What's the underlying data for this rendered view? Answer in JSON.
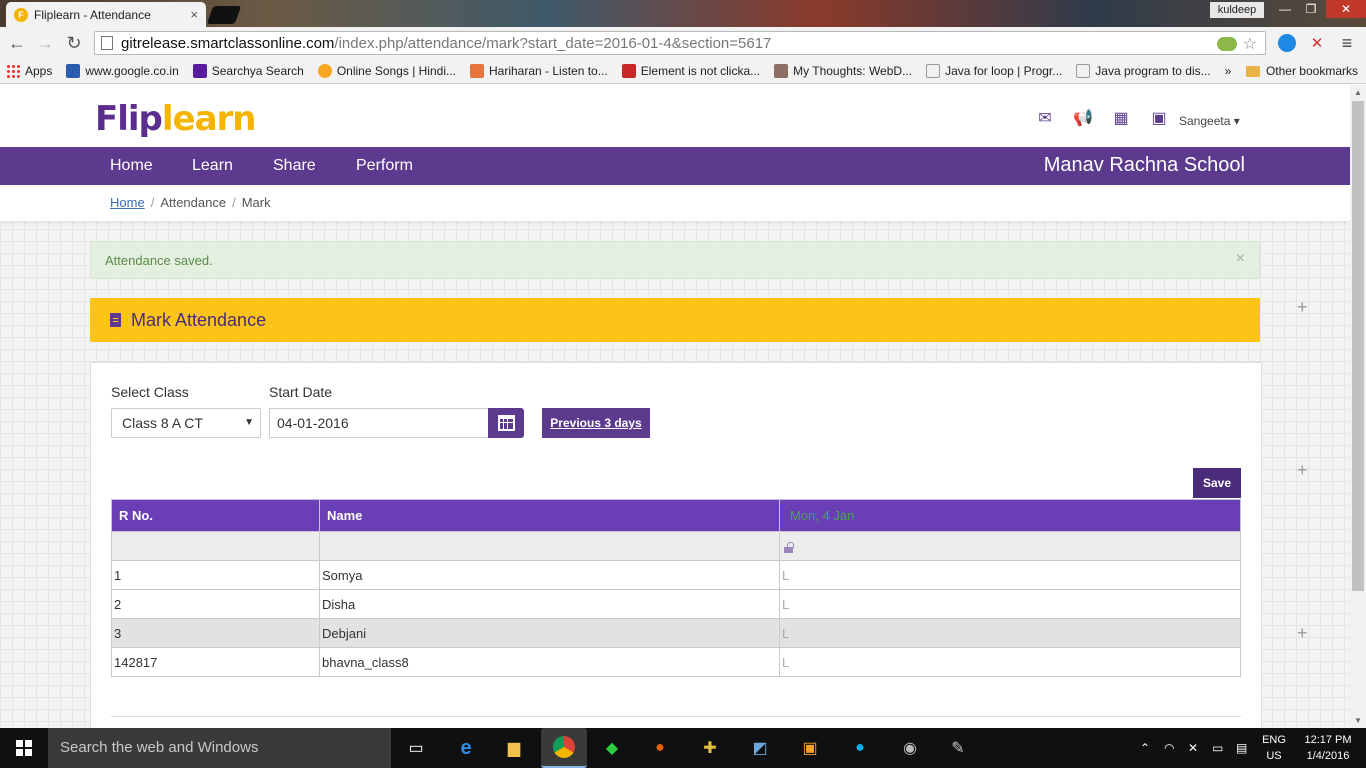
{
  "browser": {
    "tab_title": "Fliplearn - Attendance",
    "tab_favicon_letter": "F",
    "profile_name": "kuldeep",
    "url_host": "gitrelease.smartclassonline.com",
    "url_path": "/index.php/attendance/mark?start_date=2016-01-4&section=5617",
    "bookmarks": [
      {
        "label": "Apps"
      },
      {
        "label": "www.google.co.in"
      },
      {
        "label": "Searchya Search"
      },
      {
        "label": "Online Songs | Hindi..."
      },
      {
        "label": "Hariharan - Listen to..."
      },
      {
        "label": "Element is not clicka..."
      },
      {
        "label": "My Thoughts: WebD..."
      },
      {
        "label": "Java for loop | Progr..."
      },
      {
        "label": "Java program to dis..."
      }
    ],
    "bookmarks_overflow": "»",
    "other_bookmarks": "Other bookmarks"
  },
  "site": {
    "logo_part1": "Flip",
    "logo_part2": "learn",
    "user_name": "Sangeeta",
    "user_caret": "▾",
    "nav": [
      "Home",
      "Learn",
      "Share",
      "Perform"
    ],
    "school_name": "Manav Rachna School"
  },
  "breadcrumb": {
    "home": "Home",
    "sep": "/",
    "items": [
      "Attendance",
      "Mark"
    ]
  },
  "alert": {
    "message": "Attendance saved.",
    "close": "×"
  },
  "panel": {
    "title": "Mark Attendance",
    "select_class_label": "Select Class",
    "select_class_value": "Class 8 A CT",
    "start_date_label": "Start Date",
    "start_date_value": "04-01-2016",
    "prev_button": "Previous 3 days",
    "save_button": "Save"
  },
  "table": {
    "headers": [
      "R No.",
      "Name",
      "Mon, 4 Jan"
    ],
    "rows": [
      {
        "rno": "1",
        "name": "Somya",
        "status": "L"
      },
      {
        "rno": "2",
        "name": "Disha",
        "status": "L"
      },
      {
        "rno": "3",
        "name": "Debjani",
        "status": "L"
      },
      {
        "rno": "142817",
        "name": "bhavna_class8",
        "status": "L"
      }
    ]
  },
  "taskbar": {
    "search_placeholder": "Search the web and Windows",
    "lang_line1": "ENG",
    "lang_line2": "US",
    "time": "12:17 PM",
    "date": "1/4/2016"
  },
  "colors": {
    "brand_purple": "#5c3a8e",
    "brand_yellow": "#fcc419",
    "table_header": "#6a3fb5",
    "alert_bg": "#e3f0df"
  }
}
